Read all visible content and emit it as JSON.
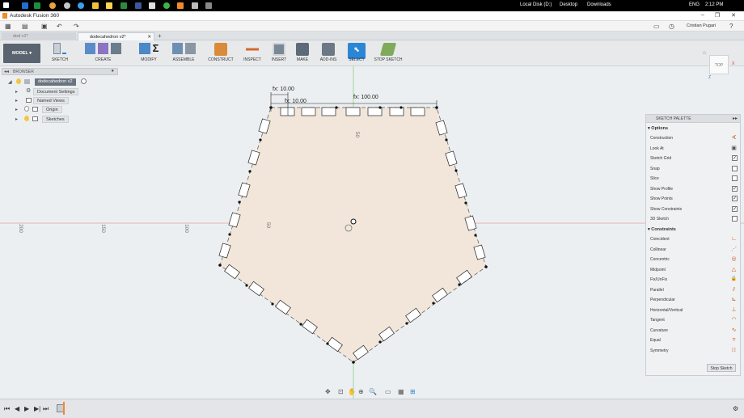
{
  "taskbar": {
    "local_disk": "Local Disk (D:)",
    "desktop": "Desktop",
    "downloads": "Downloads",
    "lang": "ENG",
    "time": "2:12 PM"
  },
  "window": {
    "title": "Autodesk Fusion 360"
  },
  "appbar": {
    "user": "Cristian Pugari"
  },
  "tabs": [
    {
      "label": "dod v1*"
    },
    {
      "label": "dodecahedron v2*"
    }
  ],
  "toolbar": {
    "mode": "MODEL",
    "groups": [
      {
        "label": "SKETCH",
        "icon": "sketch-icon"
      },
      {
        "label": "CREATE",
        "icon": "create-icon"
      },
      {
        "label": "MODIFY",
        "icon": "modify-icon"
      },
      {
        "label": "ASSEMBLE",
        "icon": "assemble-icon"
      },
      {
        "label": "CONSTRUCT",
        "icon": "construct-icon"
      },
      {
        "label": "INSPECT",
        "icon": "inspect-icon"
      },
      {
        "label": "INSERT",
        "icon": "insert-icon"
      },
      {
        "label": "MAKE",
        "icon": "make-icon"
      },
      {
        "label": "ADD-INS",
        "icon": "addins-icon"
      },
      {
        "label": "SELECT",
        "icon": "select-icon"
      },
      {
        "label": "STOP SKETCH",
        "icon": "stop-sketch-icon"
      }
    ]
  },
  "browser": {
    "title": "BROWSER",
    "root": "dodecahedron v2",
    "items": [
      {
        "label": "Document Settings"
      },
      {
        "label": "Named Views"
      },
      {
        "label": "Origin"
      },
      {
        "label": "Sketches"
      }
    ]
  },
  "viewcube": {
    "face": "TOP",
    "axis_x": "X",
    "axis_z": "Z"
  },
  "sketch": {
    "dimensions": [
      "fx: 10.00",
      "fx: 10.00",
      "fx: 100.00"
    ],
    "ruler_labels": [
      "200",
      "150",
      "100",
      "50",
      "50"
    ]
  },
  "palette": {
    "title": "SKETCH PALETTE",
    "options_title": "Options",
    "options": [
      {
        "label": "Construction",
        "type": "icon",
        "value": ""
      },
      {
        "label": "Look At",
        "type": "icon",
        "value": ""
      },
      {
        "label": "Sketch Grid",
        "type": "check",
        "value": "✓"
      },
      {
        "label": "Snap",
        "type": "check",
        "value": ""
      },
      {
        "label": "Slice",
        "type": "check",
        "value": ""
      },
      {
        "label": "Show Profile",
        "type": "check",
        "value": "✓"
      },
      {
        "label": "Show Points",
        "type": "check",
        "value": "✓"
      },
      {
        "label": "Show Constraints",
        "type": "check",
        "value": "✓"
      },
      {
        "label": "3D Sketch",
        "type": "check",
        "value": ""
      }
    ],
    "constraints_title": "Constraints",
    "constraints": [
      {
        "label": "Coincident",
        "glyph": "∟"
      },
      {
        "label": "Collinear",
        "glyph": "⋰"
      },
      {
        "label": "Concentric",
        "glyph": "◎"
      },
      {
        "label": "Midpoint",
        "glyph": "△"
      },
      {
        "label": "Fix/UnFix",
        "glyph": "🔒"
      },
      {
        "label": "Parallel",
        "glyph": "⫽"
      },
      {
        "label": "Perpendicular",
        "glyph": "⊾"
      },
      {
        "label": "Horizontal/Vertical",
        "glyph": "⊥"
      },
      {
        "label": "Tangent",
        "glyph": "◠"
      },
      {
        "label": "Curvature",
        "glyph": "∿"
      },
      {
        "label": "Equal",
        "glyph": "="
      },
      {
        "label": "Symmetry",
        "glyph": "[ ]"
      }
    ],
    "stop_button": "Stop Sketch"
  },
  "colors": {
    "accent": "#2b86d6",
    "profile_fill": "#f1e6d9",
    "constraint": "#c05a1e"
  }
}
